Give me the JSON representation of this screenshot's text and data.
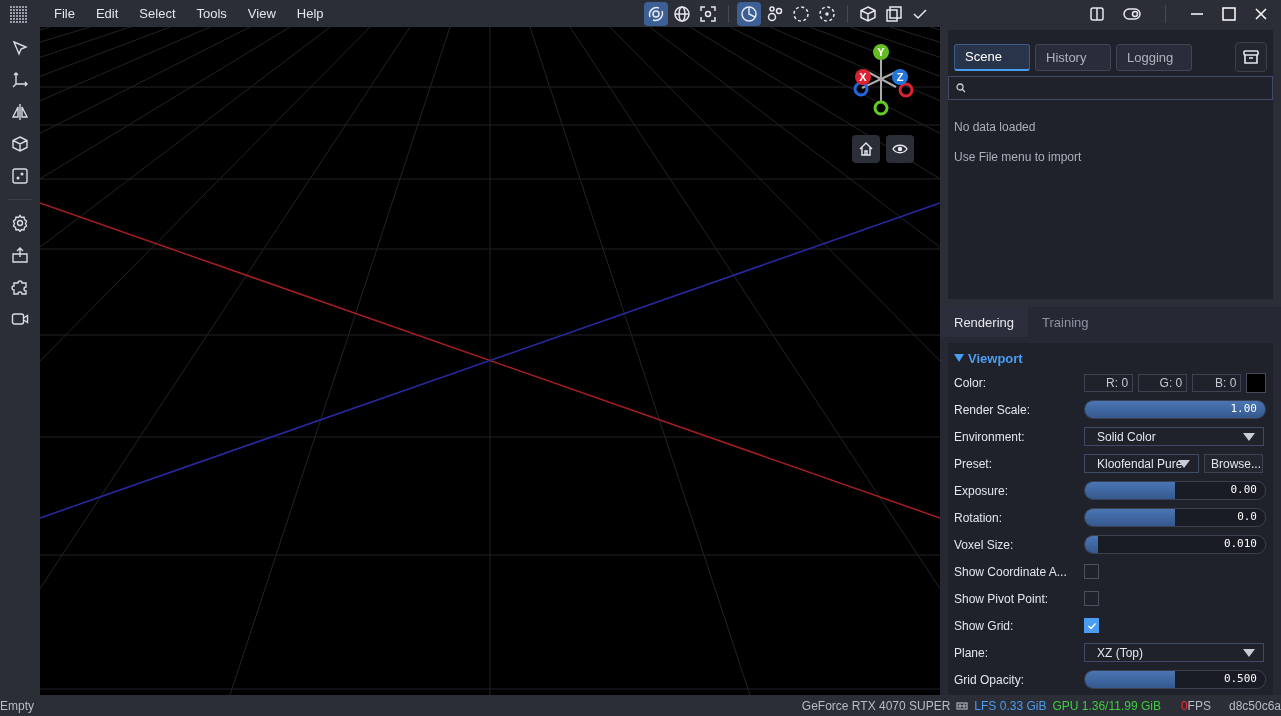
{
  "menu": [
    "File",
    "Edit",
    "Select",
    "Tools",
    "View",
    "Help"
  ],
  "toolbar": [
    {
      "selected": true
    },
    {
      "selected": false
    },
    {
      "selected": false
    },
    {
      "selected": true
    },
    {
      "selected": false
    },
    {
      "selected": false
    },
    {
      "selected": false
    },
    {
      "selected": false
    },
    {
      "selected": false
    }
  ],
  "gizmo": {
    "y": "Y",
    "x": "X",
    "z": "Z"
  },
  "scene_panel": {
    "tabs": [
      {
        "label": "Scene",
        "selected": true
      },
      {
        "label": "History",
        "selected": false
      },
      {
        "label": "Logging",
        "selected": false
      }
    ],
    "messages": [
      "No data loaded",
      "Use File menu to import"
    ]
  },
  "settings_panel": {
    "tabs": [
      {
        "label": "Rendering",
        "selected": true
      },
      {
        "label": "Training",
        "selected": false
      }
    ],
    "section": {
      "title": "Viewport",
      "expanded": true
    },
    "rows": [
      {
        "kind": "color",
        "label": "Color:",
        "fields": [
          "R: 0",
          "G: 0",
          "B: 0"
        ],
        "color": "#000000"
      },
      {
        "kind": "slider",
        "label": "Render Scale:",
        "level": 1.0,
        "reading": "1.00"
      },
      {
        "kind": "dropdown",
        "label": "Environment:",
        "value": "Solid Color"
      },
      {
        "kind": "dropdown_browse",
        "label": "Preset:",
        "value": "Kloofendal Pure",
        "button": "Browse..."
      },
      {
        "kind": "slider",
        "label": "Exposure:",
        "level": 0.5,
        "reading": "0.00"
      },
      {
        "kind": "slider",
        "label": "Rotation:",
        "level": 0.5,
        "reading": "0.0"
      },
      {
        "kind": "slider",
        "label": "Voxel Size:",
        "level": 0.06,
        "reading": "0.010"
      },
      {
        "kind": "checkbox",
        "label": "Show Coordinate A...",
        "checked": false
      },
      {
        "kind": "checkbox",
        "label": "Show Pivot Point:",
        "checked": false
      },
      {
        "kind": "checkbox",
        "label": "Show Grid:",
        "checked": true
      },
      {
        "kind": "dropdown",
        "label": "Plane:",
        "value": "XZ (Top)"
      },
      {
        "kind": "slider",
        "label": "Grid Opacity:",
        "level": 0.5,
        "reading": "0.500"
      }
    ]
  },
  "status_bar": {
    "state": "Empty",
    "gpu_name": "GeForce RTX 4070 SUPER",
    "lfs": "LFS 0.33 GiB",
    "gpu_memory": "GPU 1.36/11.99 GiB",
    "fps_value": "0",
    "fps_unit": "FPS",
    "commit": "d8c50c6a"
  }
}
